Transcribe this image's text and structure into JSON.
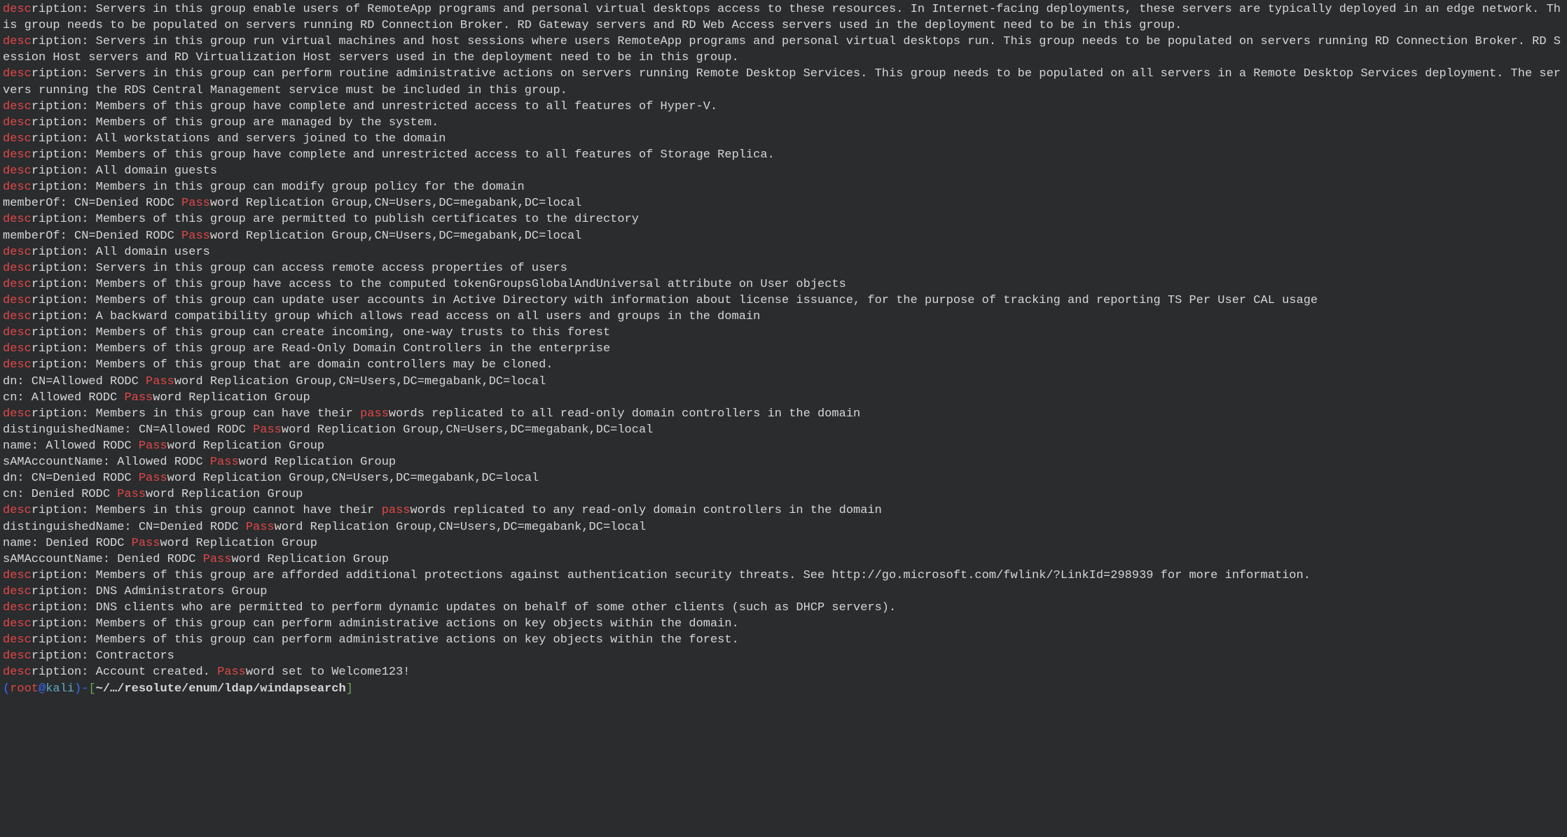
{
  "highlight_substrings": [
    "desc",
    "Pass",
    "pass"
  ],
  "lines": [
    {
      "segments": [
        {
          "text": "description: Servers in this group enable users of RemoteApp programs and personal virtual desktops access to these resources. In Internet-facing deployments, these servers are typically deployed in an edge network. This group needs to be populated on servers running RD Connection Broker. RD Gateway servers and RD Web Access servers used in the deployment need to be in this group."
        }
      ]
    },
    {
      "segments": [
        {
          "text": "description: Servers in this group run virtual machines and host sessions where users RemoteApp programs and personal virtual desktops run. This group needs to be populated on servers running RD Connection Broker. RD Session Host servers and RD Virtualization Host servers used in the deployment need to be in this group."
        }
      ]
    },
    {
      "segments": [
        {
          "text": "description: Servers in this group can perform routine administrative actions on servers running Remote Desktop Services. This group needs to be populated on all servers in a Remote Desktop Services deployment. The servers running the RDS Central Management service must be included in this group."
        }
      ]
    },
    {
      "segments": [
        {
          "text": "description: Members of this group have complete and unrestricted access to all features of Hyper-V."
        }
      ]
    },
    {
      "segments": [
        {
          "text": "description: Members of this group are managed by the system."
        }
      ]
    },
    {
      "segments": [
        {
          "text": "description: All workstations and servers joined to the domain"
        }
      ]
    },
    {
      "segments": [
        {
          "text": "description: Members of this group have complete and unrestricted access to all features of Storage Replica."
        }
      ]
    },
    {
      "segments": [
        {
          "text": "description: All domain guests"
        }
      ]
    },
    {
      "segments": [
        {
          "text": "description: Members in this group can modify group policy for the domain"
        }
      ]
    },
    {
      "segments": [
        {
          "text": "memberOf: CN=Denied RODC Password Replication Group,CN=Users,DC=megabank,DC=local"
        }
      ]
    },
    {
      "segments": [
        {
          "text": "description: Members of this group are permitted to publish certificates to the directory"
        }
      ]
    },
    {
      "segments": [
        {
          "text": "memberOf: CN=Denied RODC Password Replication Group,CN=Users,DC=megabank,DC=local"
        }
      ]
    },
    {
      "segments": [
        {
          "text": "description: All domain users"
        }
      ]
    },
    {
      "segments": [
        {
          "text": "description: Servers in this group can access remote access properties of users"
        }
      ]
    },
    {
      "segments": [
        {
          "text": "description: Members of this group have access to the computed tokenGroupsGlobalAndUniversal attribute on User objects"
        }
      ]
    },
    {
      "segments": [
        {
          "text": "description: Members of this group can update user accounts in Active Directory with information about license issuance, for the purpose of tracking and reporting TS Per User CAL usage"
        }
      ]
    },
    {
      "segments": [
        {
          "text": "description: A backward compatibility group which allows read access on all users and groups in the domain"
        }
      ]
    },
    {
      "segments": [
        {
          "text": "description: Members of this group can create incoming, one-way trusts to this forest"
        }
      ]
    },
    {
      "segments": [
        {
          "text": "description: Members of this group are Read-Only Domain Controllers in the enterprise"
        }
      ]
    },
    {
      "segments": [
        {
          "text": "description: Members of this group that are domain controllers may be cloned."
        }
      ]
    },
    {
      "segments": [
        {
          "text": "dn: CN=Allowed RODC Password Replication Group,CN=Users,DC=megabank,DC=local"
        }
      ]
    },
    {
      "segments": [
        {
          "text": "cn: Allowed RODC Password Replication Group"
        }
      ]
    },
    {
      "segments": [
        {
          "text": "description: Members in this group can have their passwords replicated to all read-only domain controllers in the domain"
        }
      ]
    },
    {
      "segments": [
        {
          "text": "distinguishedName: CN=Allowed RODC Password Replication Group,CN=Users,DC=megabank,DC=local"
        }
      ]
    },
    {
      "segments": [
        {
          "text": "name: Allowed RODC Password Replication Group"
        }
      ]
    },
    {
      "segments": [
        {
          "text": "sAMAccountName: Allowed RODC Password Replication Group"
        }
      ]
    },
    {
      "segments": [
        {
          "text": "dn: CN=Denied RODC Password Replication Group,CN=Users,DC=megabank,DC=local"
        }
      ]
    },
    {
      "segments": [
        {
          "text": "cn: Denied RODC Password Replication Group"
        }
      ]
    },
    {
      "segments": [
        {
          "text": "description: Members in this group cannot have their passwords replicated to any read-only domain controllers in the domain"
        }
      ]
    },
    {
      "segments": [
        {
          "text": "distinguishedName: CN=Denied RODC Password Replication Group,CN=Users,DC=megabank,DC=local"
        }
      ]
    },
    {
      "segments": [
        {
          "text": "name: Denied RODC Password Replication Group"
        }
      ]
    },
    {
      "segments": [
        {
          "text": "sAMAccountName: Denied RODC Password Replication Group"
        }
      ]
    },
    {
      "segments": [
        {
          "text": "description: Members of this group are afforded additional protections against authentication security threats. See http://go.microsoft.com/fwlink/?LinkId=298939 for more information."
        }
      ]
    },
    {
      "segments": [
        {
          "text": "description: DNS Administrators Group"
        }
      ]
    },
    {
      "segments": [
        {
          "text": "description: DNS clients who are permitted to perform dynamic updates on behalf of some other clients (such as DHCP servers)."
        }
      ]
    },
    {
      "segments": [
        {
          "text": "description: Members of this group can perform administrative actions on key objects within the domain."
        }
      ]
    },
    {
      "segments": [
        {
          "text": "description: Members of this group can perform administrative actions on key objects within the forest."
        }
      ]
    },
    {
      "segments": [
        {
          "text": "description: Contractors"
        }
      ]
    },
    {
      "segments": [
        {
          "text": "description: Account created. Password set to Welcome123!"
        }
      ]
    }
  ],
  "prompt": {
    "open_paren": "(",
    "user": "root",
    "at": "@",
    "host": "kali",
    "close_paren": ")",
    "dash": "-",
    "open_brkt": "[",
    "path": "~/…/resolute/enum/ldap/windapsearch",
    "close_brkt": "]"
  }
}
